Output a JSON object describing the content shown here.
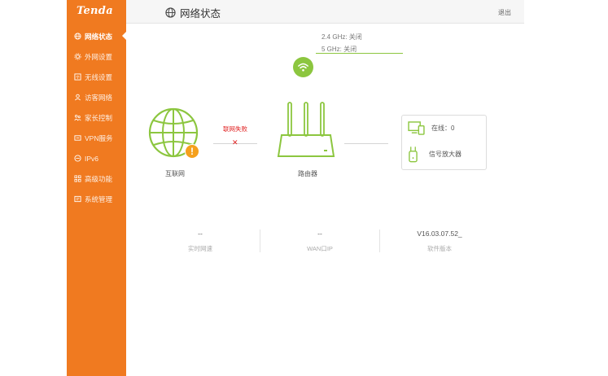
{
  "brand": {
    "logo_text": "Tenda"
  },
  "sidebar": {
    "items": [
      {
        "label": "网络状态",
        "icon": "globe-icon",
        "active": true
      },
      {
        "label": "外网设置",
        "icon": "gear-icon",
        "active": false
      },
      {
        "label": "无线设置",
        "icon": "wifi-box-icon",
        "active": false
      },
      {
        "label": "访客网络",
        "icon": "guest-icon",
        "active": false
      },
      {
        "label": "家长控制",
        "icon": "family-icon",
        "active": false
      },
      {
        "label": "VPN服务",
        "icon": "vpn-icon",
        "active": false
      },
      {
        "label": "IPv6",
        "icon": "ipv6-icon",
        "active": false
      },
      {
        "label": "高级功能",
        "icon": "grid-icon",
        "active": false
      },
      {
        "label": "系统管理",
        "icon": "system-icon",
        "active": false
      }
    ]
  },
  "header": {
    "title": "网络状态",
    "logout_label": "退出"
  },
  "wifi": {
    "band_24": "2.4 GHz: 关闭",
    "band_5": "5 GHz: 关闭"
  },
  "topology": {
    "internet_label": "互联网",
    "connection_status": "联网失败",
    "router_label": "路由器",
    "online_text": "在线：0",
    "extender_text": "信号放大器"
  },
  "stats": [
    {
      "value": "--",
      "label": "实时网速"
    },
    {
      "value": "--",
      "label": "WAN口IP"
    },
    {
      "value": "V16.03.07.52_",
      "label": "软件版本"
    }
  ],
  "colors": {
    "sidebar": "#f07a20",
    "accent_green": "#8cc63f",
    "alert_orange": "#f5a01c",
    "error_red": "#e02020"
  }
}
